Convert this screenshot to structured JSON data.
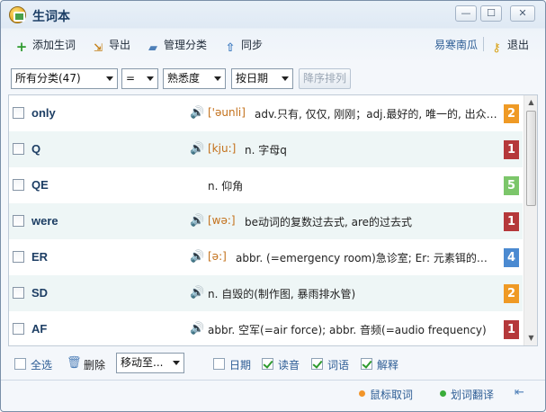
{
  "window": {
    "title": "生词本",
    "buttons": {
      "minimize": "—",
      "maximize": "☐",
      "close": "✕"
    }
  },
  "toolbar": {
    "add_label": "添加生词",
    "export_label": "导出",
    "manage_label": "管理分类",
    "sync_label": "同步",
    "user_name": "易寒南瓜",
    "exit_label": "退出",
    "icons": {
      "add": "plus-icon",
      "export": "export-icon",
      "manage": "folder-icon",
      "sync": "up-arrow-icon",
      "exit": "key-icon"
    }
  },
  "filters": {
    "category": "所有分类(47)",
    "operator": "=",
    "familiarity": "熟悉度",
    "sort": "按日期",
    "sort_desc_label": "降序排列"
  },
  "words": [
    {
      "word": "only",
      "phonetic": "['əunli]",
      "definition": "adv.只有, 仅仅, 刚刚；adj.最好的, 唯一的, 出众的 ...",
      "level": "2",
      "has_audio": true
    },
    {
      "word": "Q",
      "phonetic": "[kju:]",
      "definition": "n. 字母q",
      "level": "1",
      "has_audio": true
    },
    {
      "word": "QE",
      "phonetic": "",
      "definition": "n. 仰角",
      "level": "5",
      "has_audio": false
    },
    {
      "word": "were",
      "phonetic": "[wə:]",
      "definition": "be动词的复数过去式, are的过去式",
      "level": "1",
      "has_audio": true
    },
    {
      "word": "ER",
      "phonetic": "[ə:]",
      "definition": "abbr. (=emergency room)急诊室; Er: 元素铒的符号...",
      "level": "4",
      "has_audio": true
    },
    {
      "word": "SD",
      "phonetic": "",
      "definition": "n. 自毁的(制作图, 暴雨排水管)",
      "level": "2",
      "has_audio": true
    },
    {
      "word": "AF",
      "phonetic": "",
      "definition": "abbr. 空军(=air force); abbr. 音频(=audio frequency)",
      "level": "1",
      "has_audio": true
    }
  ],
  "level_colors": {
    "1": "#b5383a",
    "2": "#ef9a25",
    "4": "#4b8ad1",
    "5": "#7cc66a"
  },
  "bottom": {
    "select_all_label": "全选",
    "delete_label": "删除",
    "move_to_label": "移动至...",
    "date_label": "日期",
    "read_label": "读音",
    "word_label": "词语",
    "explain_label": "解释"
  },
  "status": {
    "mouse_translate_label": "鼠标取词",
    "select_translate_label": "划词翻译",
    "mouse_dot_color": "#f2952a",
    "select_dot_color": "#3aad3a"
  }
}
